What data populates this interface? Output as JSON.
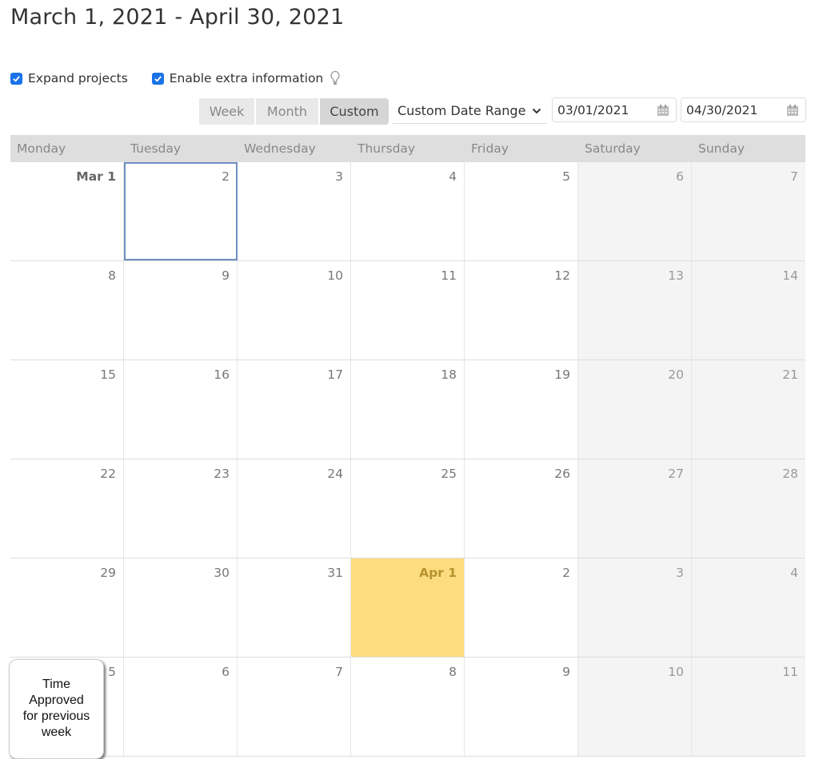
{
  "header": {
    "title": "March 1, 2021 - April 30, 2021"
  },
  "options": [
    {
      "label": "Expand projects",
      "checked": true
    },
    {
      "label": "Enable extra information",
      "checked": true,
      "icon": "lightbulb-icon"
    }
  ],
  "view_switcher": {
    "week": "Week",
    "month": "Month",
    "custom": "Custom",
    "active": "Custom"
  },
  "range_select": {
    "value": "Custom Date Range"
  },
  "date_inputs": {
    "start": "03/01/2021",
    "end": "04/30/2021"
  },
  "calendar": {
    "weekdays": [
      "Monday",
      "Tuesday",
      "Wednesday",
      "Thursday",
      "Friday",
      "Saturday",
      "Sunday"
    ],
    "weeks": [
      [
        "Mar 1",
        "2",
        "3",
        "4",
        "5",
        "6",
        "7"
      ],
      [
        "8",
        "9",
        "10",
        "11",
        "12",
        "13",
        "14"
      ],
      [
        "15",
        "16",
        "17",
        "18",
        "19",
        "20",
        "21"
      ],
      [
        "22",
        "23",
        "24",
        "25",
        "26",
        "27",
        "28"
      ],
      [
        "29",
        "30",
        "31",
        "Apr 1",
        "2",
        "3",
        "4"
      ],
      [
        "5",
        "6",
        "7",
        "8",
        "9",
        "10",
        "11"
      ]
    ],
    "selected_day": "Mar 2",
    "highlighted_day": "Apr 1",
    "accent_colors": {
      "selected_border": "#6f8fbf",
      "highlight": "#fcdc7e"
    }
  },
  "tooltip": {
    "text_lines": [
      "Time",
      "Approved",
      "for previous",
      "week"
    ]
  }
}
